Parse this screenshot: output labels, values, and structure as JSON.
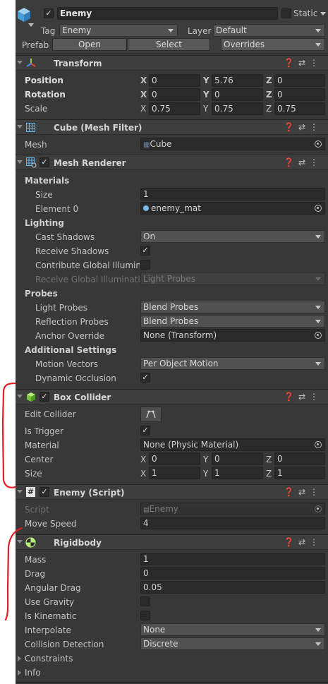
{
  "header": {
    "object_name": "Enemy",
    "active_check": "✓",
    "static_label": "Static",
    "tag_label": "Tag",
    "tag_value": "Enemy",
    "layer_label": "Layer",
    "layer_value": "Default",
    "prefab_label": "Prefab",
    "open_label": "Open",
    "select_label": "Select",
    "overrides_label": "Overrides"
  },
  "transform": {
    "title": "Transform",
    "position_label": "Position",
    "rotation_label": "Rotation",
    "scale_label": "Scale",
    "x": "X",
    "y": "Y",
    "z": "Z",
    "position": [
      "0",
      "5.76",
      "0"
    ],
    "rotation": [
      "0",
      "0",
      "0"
    ],
    "scale": [
      "0.75",
      "0.75",
      "0.75"
    ]
  },
  "mesh_filter": {
    "title": "Cube (Mesh Filter)",
    "mesh_label": "Mesh",
    "mesh_value": "Cube"
  },
  "mesh_renderer": {
    "title": "Mesh Renderer",
    "materials_label": "Materials",
    "size_label": "Size",
    "size_value": "1",
    "element0_label": "Element 0",
    "element0_value": "enemy_mat",
    "lighting_label": "Lighting",
    "cast_shadows_label": "Cast Shadows",
    "cast_shadows_value": "On",
    "receive_shadows_label": "Receive Shadows",
    "contribute_gi_label": "Contribute Global Illuminat",
    "receive_gi_label": "Receive Global Illuminatio",
    "receive_gi_value": "Light Probes",
    "probes_label": "Probes",
    "light_probes_label": "Light Probes",
    "light_probes_value": "Blend Probes",
    "reflection_probes_label": "Reflection Probes",
    "reflection_probes_value": "Blend Probes",
    "anchor_override_label": "Anchor Override",
    "anchor_override_value": "None (Transform)",
    "additional_label": "Additional Settings",
    "motion_vectors_label": "Motion Vectors",
    "motion_vectors_value": "Per Object Motion",
    "dynamic_occlusion_label": "Dynamic Occlusion"
  },
  "box_collider": {
    "title": "Box Collider",
    "edit_collider_label": "Edit Collider",
    "is_trigger_label": "Is Trigger",
    "material_label": "Material",
    "material_value": "None (Physic Material)",
    "center_label": "Center",
    "size_label": "Size",
    "center": [
      "0",
      "0",
      "0"
    ],
    "size": [
      "1",
      "1",
      "1"
    ]
  },
  "enemy_script": {
    "title": "Enemy (Script)",
    "script_label": "Script",
    "script_value": "Enemy",
    "move_speed_label": "Move Speed",
    "move_speed_value": "4"
  },
  "rigidbody": {
    "title": "Rigidbody",
    "mass_label": "Mass",
    "mass_value": "1",
    "drag_label": "Drag",
    "drag_value": "0",
    "angular_drag_label": "Angular Drag",
    "angular_drag_value": "0.05",
    "use_gravity_label": "Use Gravity",
    "is_kinematic_label": "Is Kinematic",
    "interpolate_label": "Interpolate",
    "interpolate_value": "None",
    "collision_detection_label": "Collision Detection",
    "collision_detection_value": "Discrete",
    "constraints_label": "Constraints",
    "info_label": "Info"
  },
  "checks": {
    "mark": "✓"
  },
  "colors": {
    "panel_bg": "#383838",
    "header_bg": "#3e3e3e",
    "field_bg": "#2a2a2a",
    "annotation_red": "#e21f26"
  }
}
